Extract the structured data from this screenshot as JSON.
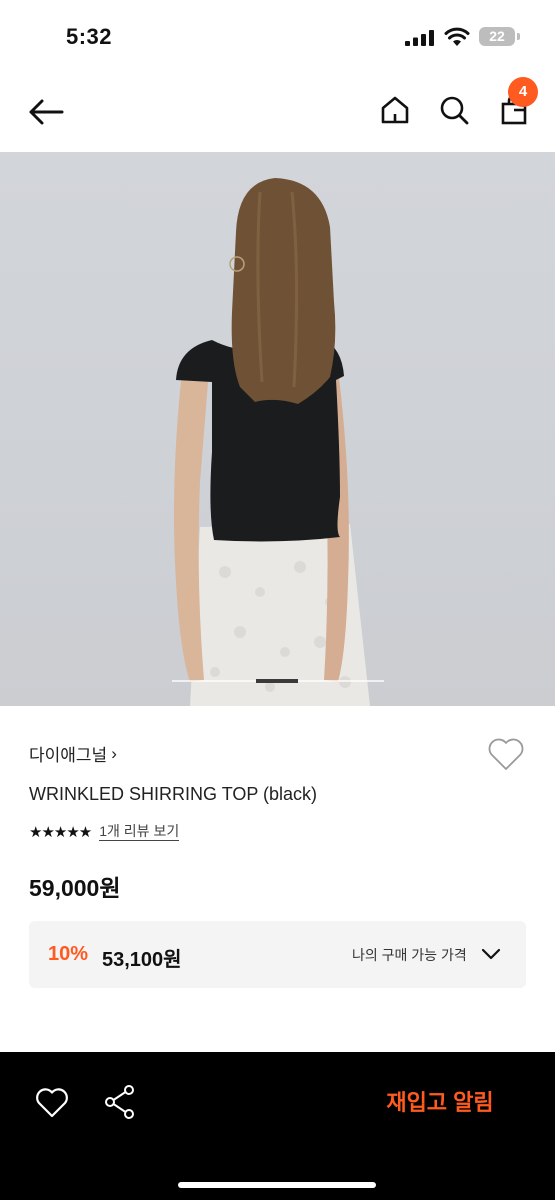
{
  "status_bar": {
    "time": "5:32",
    "battery": "22"
  },
  "header": {
    "cart_count": "4"
  },
  "product": {
    "brand": "다이애그널",
    "brand_chevron": "›",
    "title": "WRINKLED SHIRRING TOP (black)",
    "stars": "★★★★★",
    "rating": 5,
    "review_link": "1개 리뷰 보기",
    "price": "59,000원"
  },
  "my_price": {
    "discount_rate": "10%",
    "discounted_price": "53,100원",
    "label": "나의 구매 가능 가격"
  },
  "bottom_bar": {
    "restock_label": "재입고 알림"
  },
  "colors": {
    "accent": "#ff5a1f",
    "bottom_bar": "#000000",
    "price_box": "#f4f4f5"
  }
}
